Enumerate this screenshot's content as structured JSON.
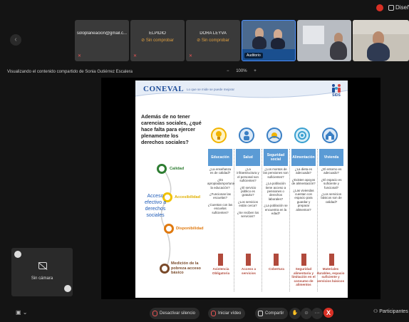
{
  "topbar": {
    "record_icon": "record-dot-icon",
    "design_label": "Diseñ"
  },
  "strip": {
    "tiles": [
      {
        "name": "soloplaneacion@gmail.c...",
        "sub": "",
        "mic": "mic-off-icon"
      },
      {
        "name": "ELPIDIO",
        "sub": "⊘ Sin comprobar",
        "mic": "mic-off-icon"
      },
      {
        "name": "DORA LEYVA",
        "sub": "⊘ Sin comprobar",
        "mic": "mic-off-icon"
      }
    ],
    "active_label": "Auditorio"
  },
  "share": {
    "text": "Visualizando el contenido compartido de Sonia Gutiérrez Escalera",
    "zoom_minus": "−",
    "zoom_value": "100%",
    "zoom_plus": "+"
  },
  "slide": {
    "brand": "CONEVAL",
    "tagline": "Lo que se mide se puede mejorar",
    "sids": "SIDS",
    "question": "Además de no tener carencias sociales, ¿qué hace falta para ejercer plenamente los derechos sociales?",
    "acceso": "Acceso efectivo a derechos sociales",
    "levels": [
      {
        "label": "Calidad",
        "color": "#2e7d32"
      },
      {
        "label": "Accesibilidad",
        "color": "#f2c200"
      },
      {
        "label": "Disponibilidad",
        "color": "#e07a10"
      },
      {
        "label": "Medición de la pobreza acceso básico",
        "color": "#7a4a2a"
      }
    ],
    "columns": [
      {
        "title": "Educación",
        "icon_color": "#f2b400",
        "items": [
          "¿La enseñanza es de calidad?",
          "¿Es apropiada/oportuna la educación?",
          "¿Funcionan las escuelas?",
          "¿Cuentan con las escuelas suficientes?"
        ],
        "outcome": "Asistencia Obligatoria"
      },
      {
        "title": "Salud",
        "icon_color": "#3a7fc4",
        "items": [
          "¿La infraestructura y el personal son suficientes?",
          "¿El servicio público es gratuito?",
          "¿Los servicios están cerca?",
          "¿Se reciben los servicios?"
        ],
        "outcome": "Acceso a servicios"
      },
      {
        "title": "Seguridad social",
        "icon_color": "#3a7fc4",
        "items": [
          "¿Los montos de las pensiones son suficientes?",
          "¿La población tiene acceso a pensiones o derechos laborales?",
          "¿La población se encuentra en la edad?"
        ],
        "outcome": "Cobertura"
      },
      {
        "title": "Alimentación",
        "icon_color": "#3aa0d0",
        "items": [
          "¿La dieta es adecuada?",
          "¿Existen apoyos de alimentación?",
          "¿Las viviendas cuentan con espacio para guardar y preparar alimentos?"
        ],
        "outcome": "Seguridad alimentaria y limitación en el consumo de alimentos"
      },
      {
        "title": "Vivienda",
        "icon_color": "#3a7fc4",
        "items": [
          "¿El entorno es adecuado?",
          "¿El espacio es suficiente y funcional?",
          "¿Los servicios básicos son de calidad?"
        ],
        "outcome": "Materiales durables, espacio suficiente y servicios básicos"
      }
    ]
  },
  "selfview": {
    "label": "Sin cámara"
  },
  "bottombar": {
    "mute_label": "Desactivar silencio",
    "video_label": "Iniciar vídeo",
    "share_label": "Compartir",
    "more_label": "···",
    "leave_label": "X",
    "participants_label": "Participantes"
  }
}
